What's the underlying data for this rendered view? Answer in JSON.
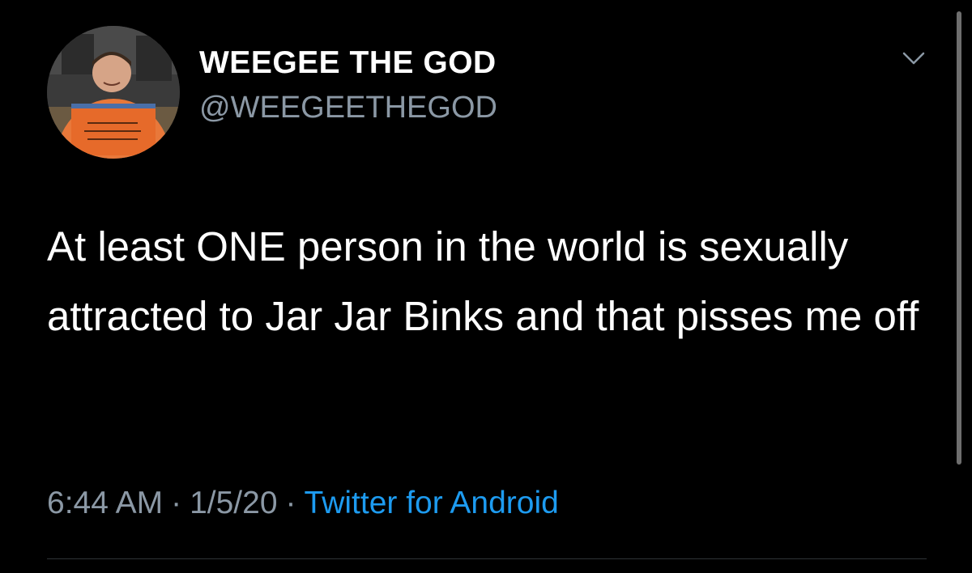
{
  "author": {
    "display_name": "WEEGEE THE GOD",
    "handle": "@WEEGEETHEGOD",
    "avatar_icon": "user-avatar-photo"
  },
  "tweet": {
    "text": "At least ONE person in the world is sexually attracted to Jar Jar Binks and that pisses me off"
  },
  "meta": {
    "time": "6:44 AM",
    "separator": "·",
    "date": "1/5/20",
    "source": "Twitter for Android"
  },
  "icons": {
    "menu": "chevron-down-icon"
  },
  "colors": {
    "background": "#000000",
    "primary_text": "#ffffff",
    "secondary_text": "#8b98a5",
    "link": "#1d9bf0"
  }
}
